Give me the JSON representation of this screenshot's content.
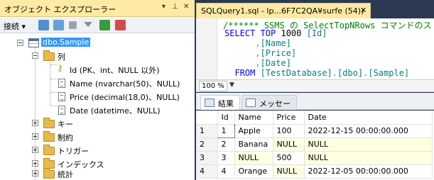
{
  "object_explorer": {
    "title": "オブジェクト エクスプローラー",
    "pin_glyph": "▾ ⊥ ✕",
    "toolbar": {
      "connect_label": "接続 ▾"
    },
    "tree": {
      "table": "dbo.Sample",
      "columns_folder": "列",
      "columns": [
        {
          "label": "Id (PK、int、NULL 以外)",
          "icon": "key-icon"
        },
        {
          "label": "Name (nvarchar(50)、NULL)",
          "icon": "column-icon"
        },
        {
          "label": "Price (decimal(18,0)、NULL)",
          "icon": "column-icon"
        },
        {
          "label": "Date (datetime、NULL)",
          "icon": "column-icon"
        }
      ],
      "folders": [
        "キー",
        "制約",
        "トリガー",
        "インデックス",
        "統計"
      ]
    }
  },
  "editor": {
    "tab_title": "SQLQuery1.sql - lp...6F7C2QA¥surfe (54))",
    "tab_close": "✕",
    "lines": [
      {
        "text": "/****** SSMS の SelectTopNRows コマンドのス",
        "style": "cm"
      },
      {
        "text": "SELECT TOP 1000 [Id]",
        "style": "mixed1"
      },
      {
        "text": "      ,[Name]",
        "style": "mixed2"
      },
      {
        "text": "      ,[Price]",
        "style": "mixed2"
      },
      {
        "text": "      ,[Date]",
        "style": "mixed2"
      },
      {
        "text": "  FROM [TestDatabase].[dbo].[Sample]",
        "style": "mixed3"
      }
    ],
    "zoom": "100 %"
  },
  "results": {
    "tabs": [
      "結果",
      "メッセージ"
    ],
    "columns": [
      "Id",
      "Name",
      "Price",
      "Date"
    ],
    "rows": [
      {
        "n": "1",
        "cells": [
          "1",
          "Apple",
          "100",
          "2022-12-15 00:00:00.000"
        ]
      },
      {
        "n": "2",
        "cells": [
          "2",
          "Banana",
          "NULL",
          "NULL"
        ]
      },
      {
        "n": "3",
        "cells": [
          "3",
          "NULL",
          "500",
          "NULL"
        ]
      },
      {
        "n": "4",
        "cells": [
          "4",
          "Orange",
          "NULL",
          "2022-12-05 00:00:00.000"
        ]
      }
    ]
  },
  "colors": {
    "title_bg": "#ffeaa3",
    "frame": "#2b3a52",
    "selection": "#3399ff",
    "null_bg": "#ffffe1"
  }
}
